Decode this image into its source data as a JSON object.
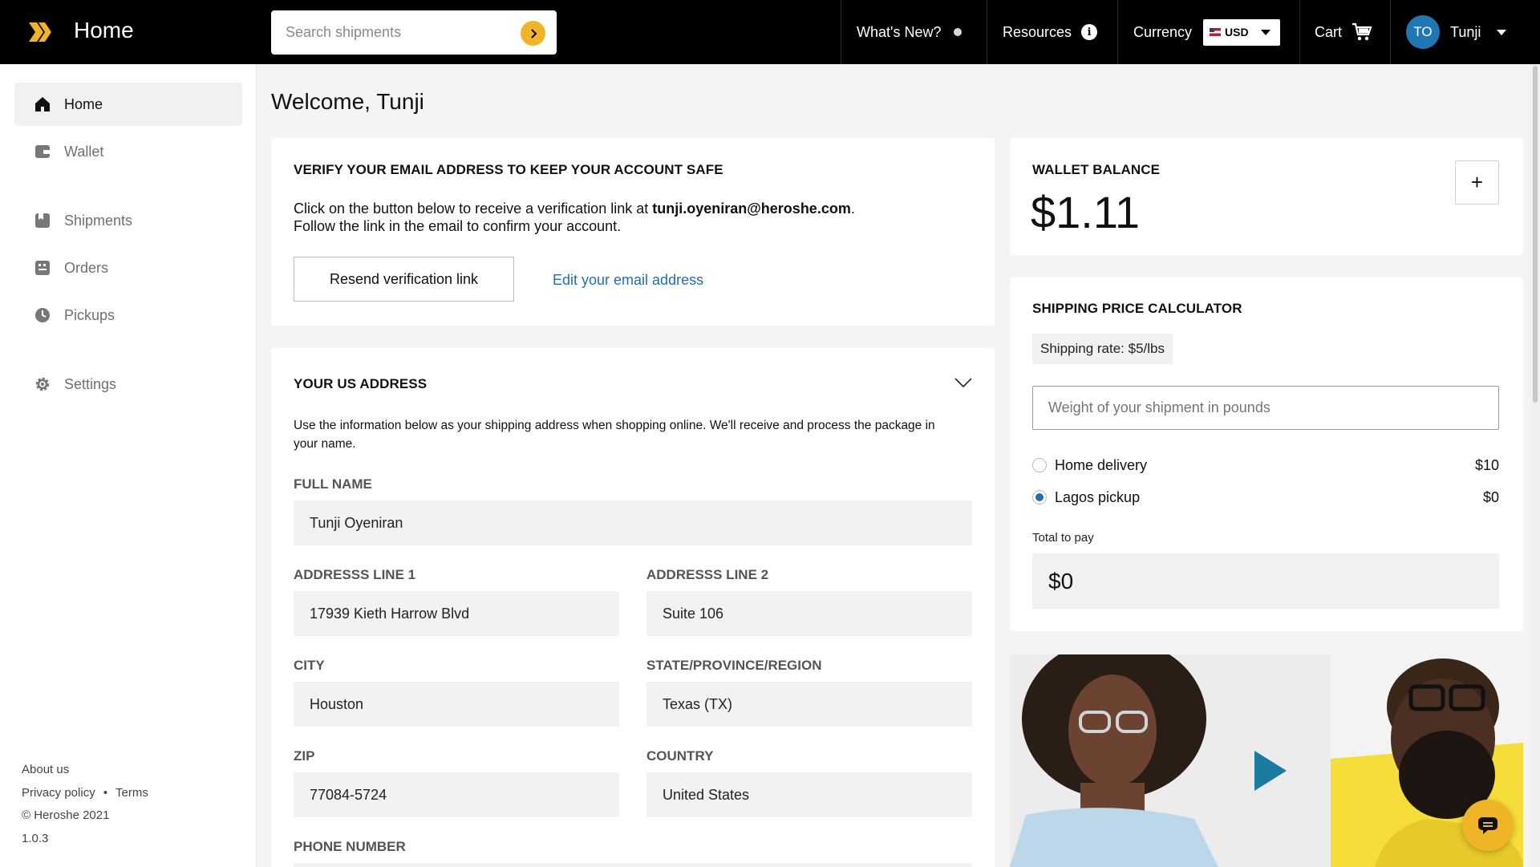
{
  "topbar": {
    "title": "Home",
    "search_placeholder": "Search shipments",
    "whats_new": "What's New?",
    "resources": "Resources",
    "currency_label": "Currency",
    "currency_value": "USD",
    "cart": "Cart",
    "avatar_initials": "TO",
    "user_name": "Tunji"
  },
  "sidebar": {
    "items": [
      {
        "label": "Home",
        "icon": "home-icon",
        "active": true
      },
      {
        "label": "Wallet",
        "icon": "wallet-icon"
      },
      {
        "label": "Shipments",
        "icon": "shipments-icon"
      },
      {
        "label": "Orders",
        "icon": "orders-icon"
      },
      {
        "label": "Pickups",
        "icon": "pickups-icon"
      },
      {
        "label": "Settings",
        "icon": "gear-icon"
      }
    ],
    "footer": {
      "about": "About us",
      "privacy": "Privacy policy",
      "separator": "•",
      "terms": "Terms",
      "copyright": "© Heroshe 2021",
      "version": "1.0.3"
    }
  },
  "main": {
    "welcome": "Welcome, Tunji",
    "verify": {
      "title": "VERIFY YOUR EMAIL ADDRESS TO KEEP YOUR ACCOUNT SAFE",
      "line1_prefix": "Click on the button below to receive a verification link at ",
      "email": "tunji.oyeniran@heroshe.com",
      "line1_suffix": ".",
      "line2": "Follow the link in the email to confirm your account.",
      "resend_button": "Resend verification link",
      "edit_link": "Edit your email address"
    },
    "address": {
      "title": "YOUR US ADDRESS",
      "description": "Use the information below as your shipping address when shopping online. We'll receive and process the package in your name.",
      "full_name_label": "FULL NAME",
      "full_name": "Tunji Oyeniran",
      "line1_label": "ADDRESSS LINE 1",
      "line1": "17939 Kieth Harrow Blvd",
      "line2_label": "ADDRESSS LINE 2",
      "line2": "Suite 106",
      "city_label": "CITY",
      "city": "Houston",
      "state_label": "STATE/PROVINCE/REGION",
      "state": "Texas (TX)",
      "zip_label": "ZIP",
      "zip": "77084-5724",
      "country_label": "COUNTRY",
      "country": "United States",
      "phone_label": "PHONE NUMBER"
    }
  },
  "wallet": {
    "title": "WALLET BALANCE",
    "balance": "$1.11",
    "add_label": "+"
  },
  "calculator": {
    "title": "SHIPPING PRICE CALCULATOR",
    "rate": "Shipping rate: $5/lbs",
    "weight_placeholder": "Weight of your shipment in pounds",
    "options": [
      {
        "label": "Home delivery",
        "price": "$10",
        "selected": false
      },
      {
        "label": "Lagos pickup",
        "price": "$0",
        "selected": true
      }
    ],
    "total_label": "Total to pay",
    "total": "$0"
  },
  "colors": {
    "accent": "#f0b429",
    "link": "#1f6fb2",
    "avatar": "#1f78b4",
    "play": "#1a7aa0"
  }
}
